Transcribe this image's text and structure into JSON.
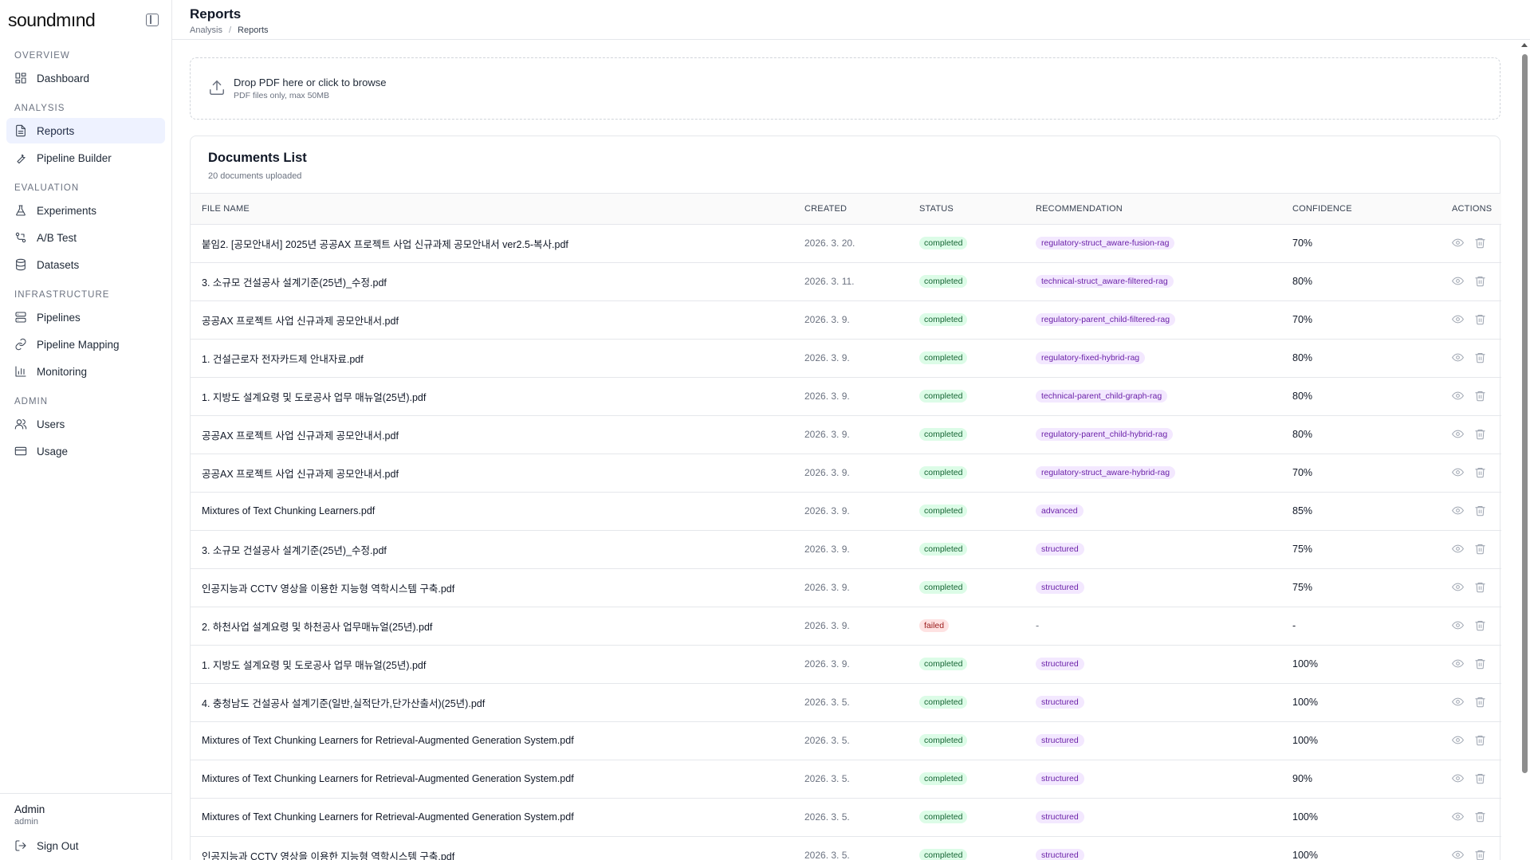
{
  "brand": {
    "name_pre": "soundm",
    "name_i": "ı",
    "name_post": "nd"
  },
  "sidebar": {
    "sections": [
      {
        "title": "OVERVIEW",
        "items": [
          {
            "label": "Dashboard",
            "icon": "dashboard-icon"
          }
        ]
      },
      {
        "title": "ANALYSIS",
        "items": [
          {
            "label": "Reports",
            "icon": "file-text-icon",
            "active": true
          },
          {
            "label": "Pipeline Builder",
            "icon": "wrench-icon"
          }
        ]
      },
      {
        "title": "EVALUATION",
        "items": [
          {
            "label": "Experiments",
            "icon": "flask-icon"
          },
          {
            "label": "A/B Test",
            "icon": "branch-icon"
          },
          {
            "label": "Datasets",
            "icon": "database-icon"
          }
        ]
      },
      {
        "title": "INFRASTRUCTURE",
        "items": [
          {
            "label": "Pipelines",
            "icon": "server-icon"
          },
          {
            "label": "Pipeline Mapping",
            "icon": "link-icon"
          },
          {
            "label": "Monitoring",
            "icon": "bar-chart-icon"
          }
        ]
      },
      {
        "title": "ADMIN",
        "items": [
          {
            "label": "Users",
            "icon": "users-icon"
          },
          {
            "label": "Usage",
            "icon": "credit-card-icon"
          }
        ]
      }
    ],
    "footer": {
      "user_name": "Admin",
      "user_role": "admin",
      "signout_label": "Sign Out"
    }
  },
  "header": {
    "title": "Reports",
    "breadcrumb": [
      "Analysis",
      "Reports"
    ]
  },
  "dropzone": {
    "title": "Drop PDF here or click to browse",
    "subtitle": "PDF files only, max 50MB"
  },
  "documents": {
    "title": "Documents List",
    "subtitle": "20 documents uploaded",
    "columns": [
      "FILE NAME",
      "CREATED",
      "STATUS",
      "RECOMMENDATION",
      "CONFIDENCE",
      "ACTIONS"
    ],
    "rows": [
      {
        "file": "붙임2. [공모안내서] 2025년 공공AX 프로젝트 사업 신규과제 공모안내서 ver2.5-복사.pdf",
        "created": "2026. 3. 20.",
        "status": "completed",
        "rec": "regulatory-struct_aware-fusion-rag",
        "conf": "70%"
      },
      {
        "file": "3. 소규모 건설공사 설계기준(25년)_수정.pdf",
        "created": "2026. 3. 11.",
        "status": "completed",
        "rec": "technical-struct_aware-filtered-rag",
        "conf": "80%"
      },
      {
        "file": "공공AX 프로젝트 사업 신규과제 공모안내서.pdf",
        "created": "2026. 3. 9.",
        "status": "completed",
        "rec": "regulatory-parent_child-filtered-rag",
        "conf": "70%"
      },
      {
        "file": "1. 건설근로자 전자카드제 안내자료.pdf",
        "created": "2026. 3. 9.",
        "status": "completed",
        "rec": "regulatory-fixed-hybrid-rag",
        "conf": "80%"
      },
      {
        "file": "1. 지방도 설계요령 및 도로공사 업무 매뉴얼(25년).pdf",
        "created": "2026. 3. 9.",
        "status": "completed",
        "rec": "technical-parent_child-graph-rag",
        "conf": "80%"
      },
      {
        "file": "공공AX 프로젝트 사업 신규과제 공모안내서.pdf",
        "created": "2026. 3. 9.",
        "status": "completed",
        "rec": "regulatory-parent_child-hybrid-rag",
        "conf": "80%"
      },
      {
        "file": "공공AX 프로젝트 사업 신규과제 공모안내서.pdf",
        "created": "2026. 3. 9.",
        "status": "completed",
        "rec": "regulatory-struct_aware-hybrid-rag",
        "conf": "70%"
      },
      {
        "file": "Mixtures of Text Chunking Learners.pdf",
        "created": "2026. 3. 9.",
        "status": "completed",
        "rec": "advanced",
        "conf": "85%"
      },
      {
        "file": "3. 소규모 건설공사 설계기준(25년)_수정.pdf",
        "created": "2026. 3. 9.",
        "status": "completed",
        "rec": "structured",
        "conf": "75%"
      },
      {
        "file": "인공지능과 CCTV 영상을 이용한 지능형 역학시스템 구축.pdf",
        "created": "2026. 3. 9.",
        "status": "completed",
        "rec": "structured",
        "conf": "75%"
      },
      {
        "file": "2. 하천사업 설계요령 및 하천공사 업무매뉴얼(25년).pdf",
        "created": "2026. 3. 9.",
        "status": "failed",
        "rec": "-",
        "conf": "-"
      },
      {
        "file": "1. 지방도 설계요령 및 도로공사 업무 매뉴얼(25년).pdf",
        "created": "2026. 3. 9.",
        "status": "completed",
        "rec": "structured",
        "conf": "100%"
      },
      {
        "file": "4. 충청남도 건설공사 설계기준(일반,실적단가,단가산출서)(25년).pdf",
        "created": "2026. 3. 5.",
        "status": "completed",
        "rec": "structured",
        "conf": "100%"
      },
      {
        "file": "Mixtures of Text Chunking Learners for Retrieval-Augmented Generation System.pdf",
        "created": "2026. 3. 5.",
        "status": "completed",
        "rec": "structured",
        "conf": "100%"
      },
      {
        "file": "Mixtures of Text Chunking Learners for Retrieval-Augmented Generation System.pdf",
        "created": "2026. 3. 5.",
        "status": "completed",
        "rec": "structured",
        "conf": "90%"
      },
      {
        "file": "Mixtures of Text Chunking Learners for Retrieval-Augmented Generation System.pdf",
        "created": "2026. 3. 5.",
        "status": "completed",
        "rec": "structured",
        "conf": "100%"
      },
      {
        "file": "인공지능과 CCTV 영상을 이용한 지능형 역학시스템 구축.pdf",
        "created": "2026. 3. 5.",
        "status": "completed",
        "rec": "structured",
        "conf": "100%"
      }
    ]
  },
  "colors": {
    "active_nav_bg": "#eef2ff",
    "completed_bg": "#dcfce7",
    "completed_fg": "#166534",
    "failed_bg": "#fee2e2",
    "failed_fg": "#991b1b",
    "rec_bg": "#f3e8ff",
    "rec_fg": "#6b21a8"
  }
}
